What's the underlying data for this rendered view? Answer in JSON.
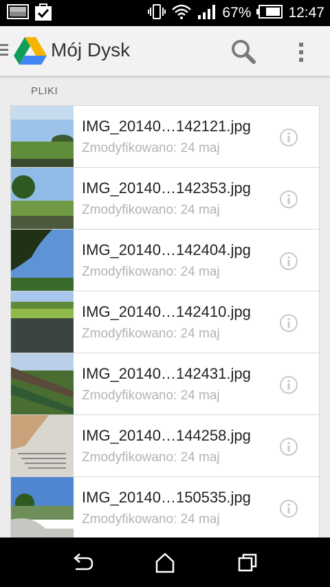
{
  "status_bar": {
    "left_icons": [
      "photo-notification-icon",
      "check-bag-notification-icon"
    ],
    "right_icons": [
      "vibrate-icon",
      "wifi-icon",
      "signal-icon",
      "battery-icon"
    ],
    "battery_percent": "67%",
    "time": "12:47"
  },
  "action_bar": {
    "title": "Mój Dysk",
    "icons": [
      "drive-logo-icon",
      "search-icon",
      "overflow-menu-icon"
    ]
  },
  "section": {
    "label": "PLIKI"
  },
  "files": [
    {
      "name": "IMG_20140…142121.jpg",
      "modified": "Zmodyfikowano: 24 maj"
    },
    {
      "name": "IMG_20140…142353.jpg",
      "modified": "Zmodyfikowano: 24 maj"
    },
    {
      "name": "IMG_20140…142404.jpg",
      "modified": "Zmodyfikowano: 24 maj"
    },
    {
      "name": "IMG_20140…142410.jpg",
      "modified": "Zmodyfikowano: 24 maj"
    },
    {
      "name": "IMG_20140…142431.jpg",
      "modified": "Zmodyfikowano: 24 maj"
    },
    {
      "name": "IMG_20140…144258.jpg",
      "modified": "Zmodyfikowano: 24 maj"
    },
    {
      "name": "IMG_20140…150535.jpg",
      "modified": "Zmodyfikowano: 24 maj"
    }
  ],
  "nav_bar": {
    "icons": [
      "back-icon",
      "home-icon",
      "recent-apps-icon"
    ]
  },
  "colors": {
    "status_bar": "#000000",
    "action_bar": "#f2f2f2",
    "background": "#ececec",
    "drive_green": "#0f9d58",
    "drive_yellow": "#f4b400",
    "drive_blue": "#4285f4"
  }
}
